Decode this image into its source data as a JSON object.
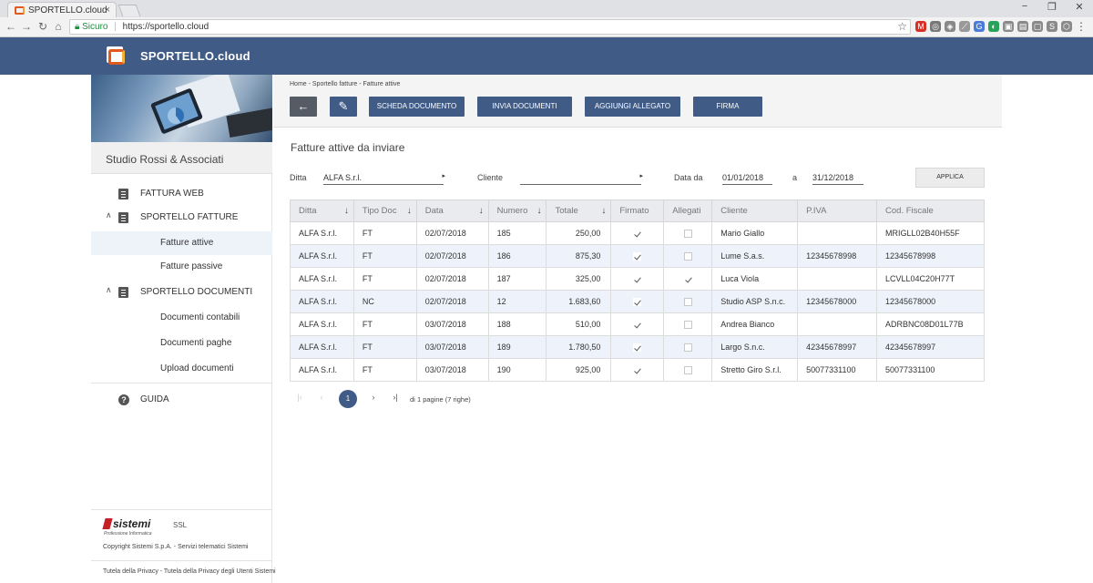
{
  "browser": {
    "tab_title": "SPORTELLO.cloud",
    "tab_close": "×",
    "secure_label": "Sicuro",
    "url": "https://sportello.cloud",
    "window_controls": [
      "−",
      "❐",
      "✕"
    ],
    "extensions": [
      {
        "icon": "gmail-icon",
        "color": "#d93025",
        "glyph": "M"
      },
      {
        "icon": "opera-icon",
        "color": "#777777",
        "glyph": "◎"
      },
      {
        "icon": "shield-ext-icon",
        "color": "#888888",
        "glyph": "◈"
      },
      {
        "icon": "feather-ext-icon",
        "color": "#999999",
        "glyph": "⟋"
      },
      {
        "icon": "translate-icon",
        "color": "#4a7bd8",
        "glyph": "G"
      },
      {
        "icon": "grammar-icon",
        "color": "#2aa35a",
        "glyph": "◐"
      },
      {
        "icon": "ext-gray-1-icon",
        "color": "#8a8a8a",
        "glyph": "▣"
      },
      {
        "icon": "ext-gray-2-icon",
        "color": "#8a8a8a",
        "glyph": "▤"
      },
      {
        "icon": "ext-gray-3-icon",
        "color": "#8a8a8a",
        "glyph": "▢"
      },
      {
        "icon": "skype-icon",
        "color": "#8a8a8a",
        "glyph": "S"
      },
      {
        "icon": "ext-gray-4-icon",
        "color": "#8a8a8a",
        "glyph": "⬡"
      },
      {
        "icon": "menu-dots-icon",
        "color": "#f2f2f2",
        "glyph": "⋮"
      }
    ]
  },
  "app": {
    "title": "SPORTELLO.cloud",
    "brand_color": "#3f5b86"
  },
  "sidebar": {
    "studio_name": "Studio Rossi & Associati",
    "items": [
      {
        "name": "fattura-web",
        "label": "FATTURA WEB",
        "icon": "document-icon",
        "level": 0
      },
      {
        "name": "sportello-fatture",
        "label": "SPORTELLO FATTURE",
        "icon": "badge-icon",
        "chevron": "∧",
        "level": 0
      },
      {
        "name": "fatture-attive",
        "label": "Fatture attive",
        "level": 1,
        "active": true
      },
      {
        "name": "fatture-passive",
        "label": "Fatture passive",
        "level": 1
      },
      {
        "name": "sportello-documenti",
        "label": "SPORTELLO DOCUMENTI",
        "icon": "badge-icon",
        "chevron": "∧",
        "level": 0
      },
      {
        "name": "documenti-contabili",
        "label": "Documenti contabili",
        "level": 1
      },
      {
        "name": "documenti-paghe",
        "label": "Documenti paghe",
        "level": 1
      },
      {
        "name": "upload-documenti",
        "label": "Upload documenti",
        "level": 1
      },
      {
        "name": "guida",
        "label": "GUIDA",
        "icon": "help-icon",
        "level": 0
      }
    ],
    "footer": {
      "logo_word": "sistemi",
      "logo_tag": "Professione Informatica",
      "ssl": "SSL",
      "copyright": "Copyright Sistemi S.p.A. - Servizi telematici Sistemi",
      "privacy": "Tutela della Privacy - Tutela della Privacy degli Utenti Sistemi"
    }
  },
  "toolbar": {
    "breadcrumb": "Home - Sportello fatture - Fatture attive",
    "back_glyph": "←",
    "edit_glyph": "✎",
    "buttons": [
      "SCHEDA DOCUMENTO",
      "INVIA DOCUMENTI",
      "AGGIUNGI ALLEGATO",
      "FIRMA"
    ]
  },
  "main": {
    "section_title": "Fatture attive da inviare",
    "filters": {
      "ditta_label": "Ditta",
      "ditta_value": "ALFA S.r.l.",
      "cliente_label": "Cliente",
      "cliente_value": "",
      "data_da_label": "Data da",
      "data_da_value": "01/01/2018",
      "a_label": "a",
      "data_a_value": "31/12/2018",
      "apply_label": "APPLICA"
    },
    "table": {
      "columns": [
        {
          "label": "Ditta",
          "sortable": true
        },
        {
          "label": "Tipo Doc",
          "sortable": true
        },
        {
          "label": "Data",
          "sortable": true
        },
        {
          "label": "Numero",
          "sortable": true
        },
        {
          "label": "Totale",
          "sortable": true
        },
        {
          "label": "Firmato",
          "sortable": false
        },
        {
          "label": "Allegati",
          "sortable": false
        },
        {
          "label": "Cliente",
          "sortable": false
        },
        {
          "label": "P.IVA",
          "sortable": false
        },
        {
          "label": "Cod. Fiscale",
          "sortable": false
        }
      ],
      "rows": [
        {
          "ditta": "ALFA S.r.l.",
          "tipo": "FT",
          "data": "02/07/2018",
          "numero": "185",
          "totale": "250,00",
          "firmato": true,
          "allegati": false,
          "cliente": "Mario Giallo",
          "piva": "",
          "cf": "MRIGLL02B40H55F"
        },
        {
          "ditta": "ALFA S.r.l.",
          "tipo": "FT",
          "data": "02/07/2018",
          "numero": "186",
          "totale": "875,30",
          "firmato": true,
          "allegati": false,
          "cliente": "Lume S.a.s.",
          "piva": "12345678998",
          "cf": "12345678998"
        },
        {
          "ditta": "ALFA S.r.l.",
          "tipo": "FT",
          "data": "02/07/2018",
          "numero": "187",
          "totale": "325,00",
          "firmato": true,
          "allegati": true,
          "cliente": "Luca Viola",
          "piva": "",
          "cf": "LCVLL04C20H77T"
        },
        {
          "ditta": "ALFA S.r.l.",
          "tipo": "NC",
          "data": "02/07/2018",
          "numero": "12",
          "totale": "1.683,60",
          "firmato": true,
          "allegati": false,
          "cliente": "Studio ASP S.n.c.",
          "piva": "12345678000",
          "cf": "12345678000"
        },
        {
          "ditta": "ALFA S.r.l.",
          "tipo": "FT",
          "data": "03/07/2018",
          "numero": "188",
          "totale": "510,00",
          "firmato": true,
          "allegati": false,
          "cliente": "Andrea Bianco",
          "piva": "",
          "cf": "ADRBNC08D01L77B"
        },
        {
          "ditta": "ALFA S.r.l.",
          "tipo": "FT",
          "data": "03/07/2018",
          "numero": "189",
          "totale": "1.780,50",
          "firmato": true,
          "allegati": false,
          "cliente": "Largo S.n.c.",
          "piva": "42345678997",
          "cf": "42345678997"
        },
        {
          "ditta": "ALFA S.r.l.",
          "tipo": "FT",
          "data": "03/07/2018",
          "numero": "190",
          "totale": "925,00",
          "firmato": true,
          "allegati": false,
          "cliente": "Stretto Giro S.r.l.",
          "piva": "50077331100",
          "cf": "50077331100"
        }
      ]
    },
    "pager": {
      "first": "|‹",
      "prev": "‹",
      "current": "1",
      "next": "›",
      "last": "›|",
      "info_prefix": "di",
      "info_pages": "1",
      "info_suffix": "pagine (7 righe)"
    }
  }
}
